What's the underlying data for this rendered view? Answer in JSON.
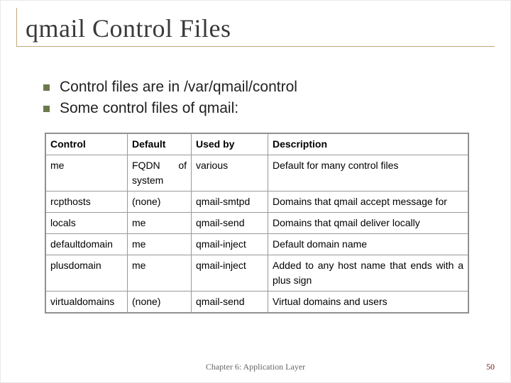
{
  "title": "qmail Control Files",
  "bullets": [
    "Control files are in /var/qmail/control",
    "Some control files of qmail:"
  ],
  "table": {
    "headers": [
      "Control",
      "Default",
      "Used by",
      "Description"
    ],
    "rows": [
      {
        "control": "me",
        "default": "FQDN of system",
        "used_by": "various",
        "description": "Default for many control files"
      },
      {
        "control": "rcpthosts",
        "default": "(none)",
        "used_by": "qmail-smtpd",
        "description": "Domains that qmail accept message for"
      },
      {
        "control": "locals",
        "default": "me",
        "used_by": "qmail-send",
        "description": "Domains that qmail deliver locally"
      },
      {
        "control": "defaultdomain",
        "default": "me",
        "used_by": "qmail-inject",
        "description": "Default domain name"
      },
      {
        "control": "plusdomain",
        "default": "me",
        "used_by": "qmail-inject",
        "description": "Added to any host name that ends with a plus sign"
      },
      {
        "control": "virtualdomains",
        "default": "(none)",
        "used_by": "qmail-send",
        "description": "Virtual domains and users"
      }
    ]
  },
  "footer": {
    "center": "Chapter 6: Application Layer",
    "page": "50"
  },
  "chart_data": {
    "type": "table",
    "title": "qmail Control Files",
    "columns": [
      "Control",
      "Default",
      "Used by",
      "Description"
    ],
    "rows": [
      [
        "me",
        "FQDN of system",
        "various",
        "Default for many control files"
      ],
      [
        "rcpthosts",
        "(none)",
        "qmail-smtpd",
        "Domains that qmail accept message for"
      ],
      [
        "locals",
        "me",
        "qmail-send",
        "Domains that qmail deliver locally"
      ],
      [
        "defaultdomain",
        "me",
        "qmail-inject",
        "Default domain name"
      ],
      [
        "plusdomain",
        "me",
        "qmail-inject",
        "Added to any host name that ends with a plus sign"
      ],
      [
        "virtualdomains",
        "(none)",
        "qmail-send",
        "Virtual domains and users"
      ]
    ]
  }
}
